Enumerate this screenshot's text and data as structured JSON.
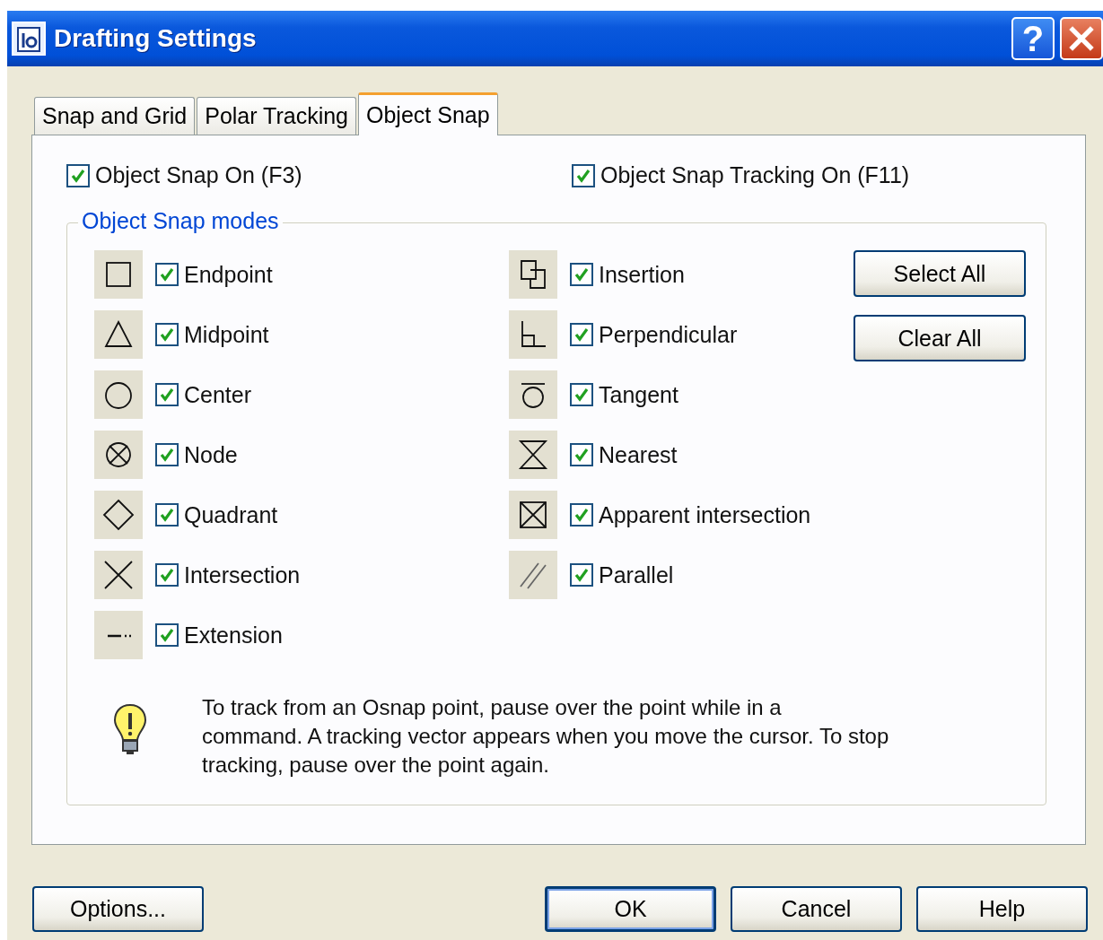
{
  "window": {
    "title": "Drafting Settings",
    "help_button": "?"
  },
  "tabs": [
    {
      "label": "Snap and Grid",
      "selected": false
    },
    {
      "label": "Polar Tracking",
      "selected": false
    },
    {
      "label": "Object Snap",
      "selected": true
    }
  ],
  "top_options": [
    {
      "label": "Object Snap On (F3)",
      "checked": true
    },
    {
      "label": "Object Snap Tracking On (F11)",
      "checked": true
    }
  ],
  "modes_group": {
    "title": "Object Snap modes",
    "columns": [
      [
        {
          "kind": "endpoint",
          "label": "Endpoint",
          "checked": true
        },
        {
          "kind": "midpoint",
          "label": "Midpoint",
          "checked": true
        },
        {
          "kind": "center",
          "label": "Center",
          "checked": true
        },
        {
          "kind": "node",
          "label": "Node",
          "checked": true
        },
        {
          "kind": "quadrant",
          "label": "Quadrant",
          "checked": true
        },
        {
          "kind": "intersection",
          "label": "Intersection",
          "checked": true
        },
        {
          "kind": "extension",
          "label": "Extension",
          "checked": true
        }
      ],
      [
        {
          "kind": "insertion",
          "label": "Insertion",
          "checked": true
        },
        {
          "kind": "perpendicular",
          "label": "Perpendicular",
          "checked": true
        },
        {
          "kind": "tangent",
          "label": "Tangent",
          "checked": true
        },
        {
          "kind": "nearest",
          "label": "Nearest",
          "checked": true
        },
        {
          "kind": "apparent",
          "label": "Apparent intersection",
          "checked": true
        },
        {
          "kind": "parallel",
          "label": "Parallel",
          "checked": true
        }
      ]
    ],
    "buttons": [
      {
        "label": "Select All"
      },
      {
        "label": "Clear All"
      }
    ],
    "hint": "To track from an Osnap point, pause over the point while in a\ncommand.  A tracking vector appears when you move the cursor.  To stop\ntracking, pause over the point again."
  },
  "footer_buttons": [
    {
      "label": "Options...",
      "default": false
    },
    {
      "label": "OK",
      "default": true
    },
    {
      "label": "Cancel",
      "default": false
    },
    {
      "label": "Help",
      "default": false
    }
  ]
}
